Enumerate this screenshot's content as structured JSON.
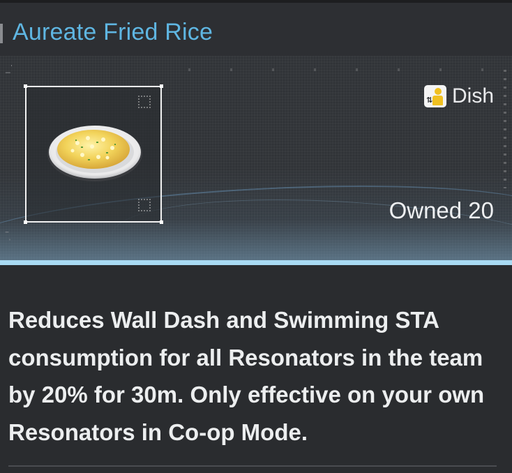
{
  "item": {
    "name": "Aureate Fried Rice",
    "category": "Dish",
    "owned": "Owned 20",
    "description": "Reduces Wall Dash and Swimming STA consumption for all Resonators in the team by 20% for 30m. Only effective on your own Resonators in Co-op Mode."
  },
  "icons": {
    "category_icon": "dish-category-icon",
    "item_image": "fried-rice-plate"
  },
  "colors": {
    "title": "#5fb6e2",
    "accent_bar": "#a9dbf3",
    "category_icon_yellow": "#f0c020"
  }
}
